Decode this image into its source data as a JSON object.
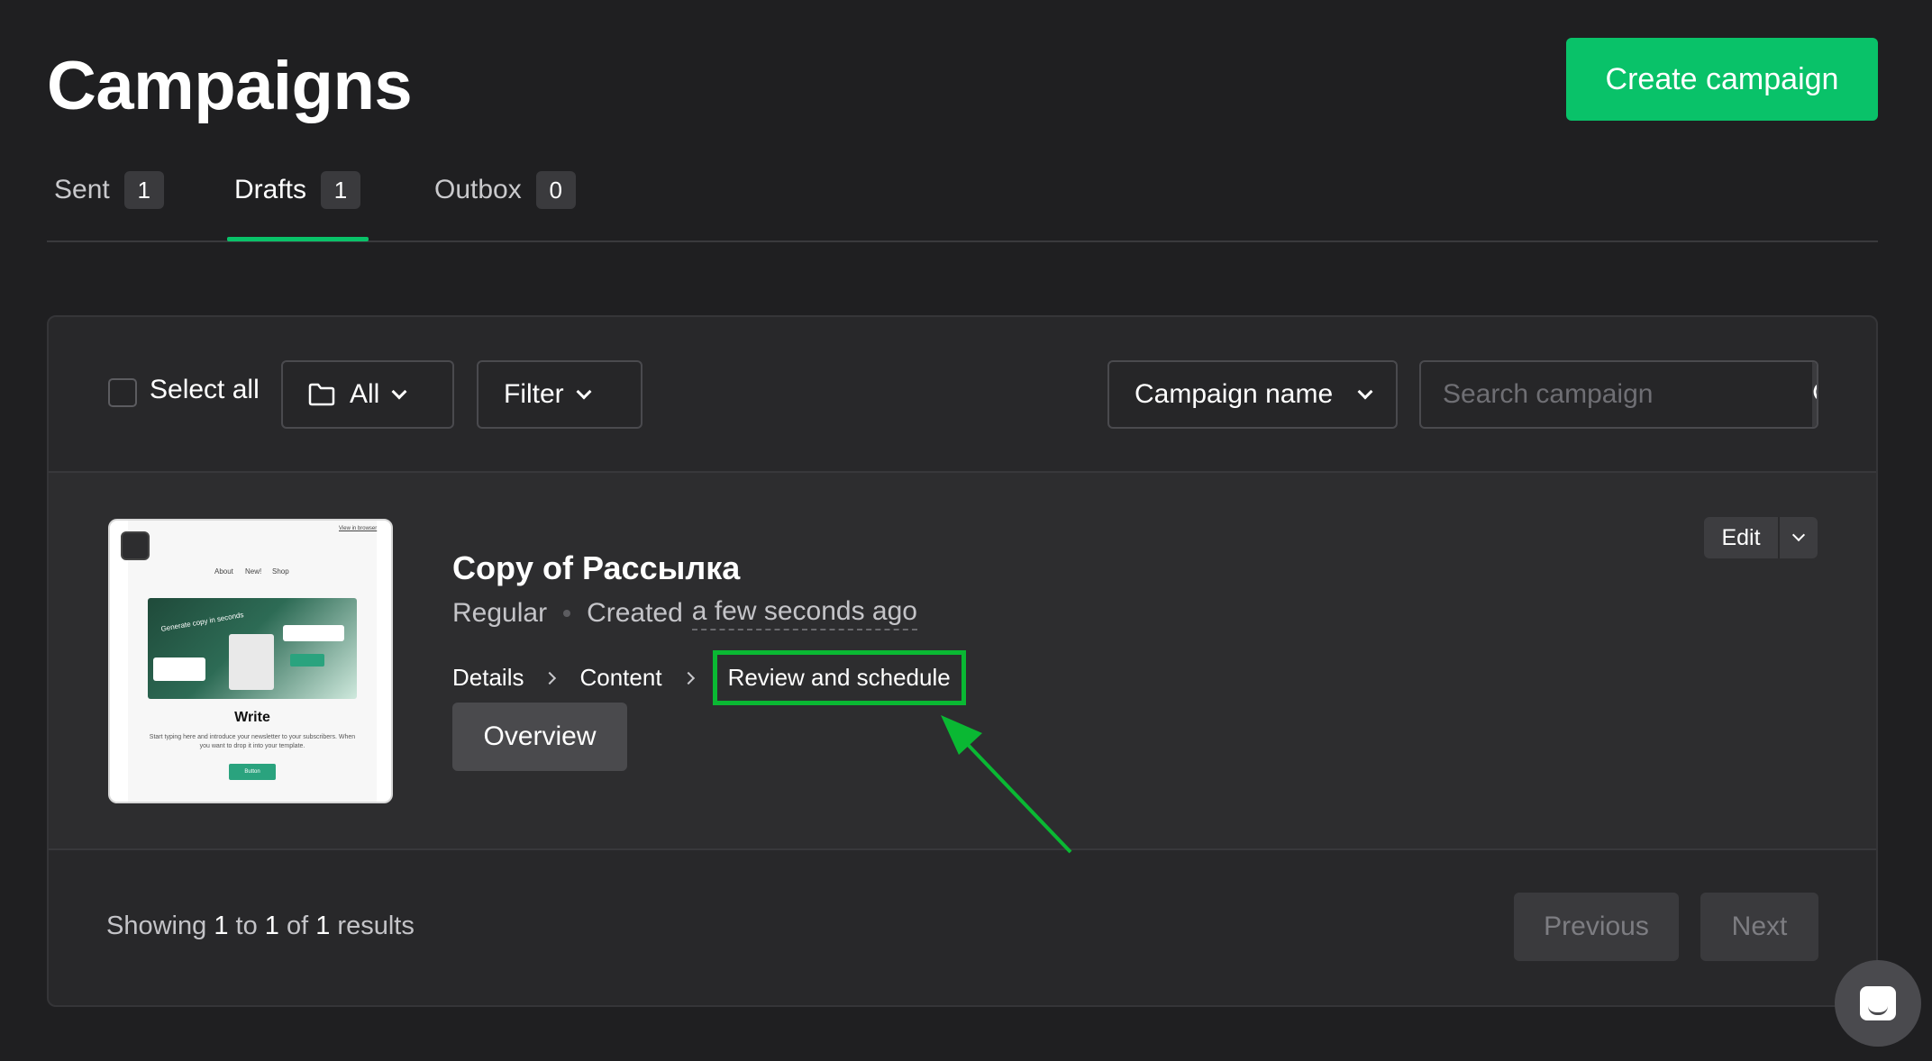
{
  "header": {
    "title": "Campaigns",
    "create_button": "Create campaign"
  },
  "tabs": [
    {
      "label": "Sent",
      "count": "1",
      "active": false
    },
    {
      "label": "Drafts",
      "count": "1",
      "active": true
    },
    {
      "label": "Outbox",
      "count": "0",
      "active": false
    }
  ],
  "toolbar": {
    "select_all": "Select all",
    "folder_label": "All",
    "filter_label": "Filter",
    "sort_label": "Campaign name",
    "search_placeholder": "Search campaign"
  },
  "campaign": {
    "title": "Copy of Рассылка",
    "type": "Regular",
    "created_prefix": "Created",
    "created_time": "a few seconds ago",
    "steps": [
      "Details",
      "Content",
      "Review and schedule"
    ],
    "overview_button": "Overview",
    "edit_button": "Edit",
    "thumbnail": {
      "top_link": "View in browser",
      "nav": [
        "About",
        "New!",
        "Shop"
      ],
      "hero_text": "Generate copy in seconds",
      "heading": "Write",
      "description": "Start typing here and introduce your newsletter to your subscribers. When you want to drop it into your template.",
      "button": "Button"
    }
  },
  "footer": {
    "showing": "Showing",
    "from": "1",
    "to_word": "to",
    "to": "1",
    "of_word": "of",
    "total": "1",
    "results_word": "results",
    "previous": "Previous",
    "next": "Next"
  },
  "colors": {
    "accent": "#09c269",
    "highlight": "#0ab833",
    "background": "#1f1f21"
  }
}
